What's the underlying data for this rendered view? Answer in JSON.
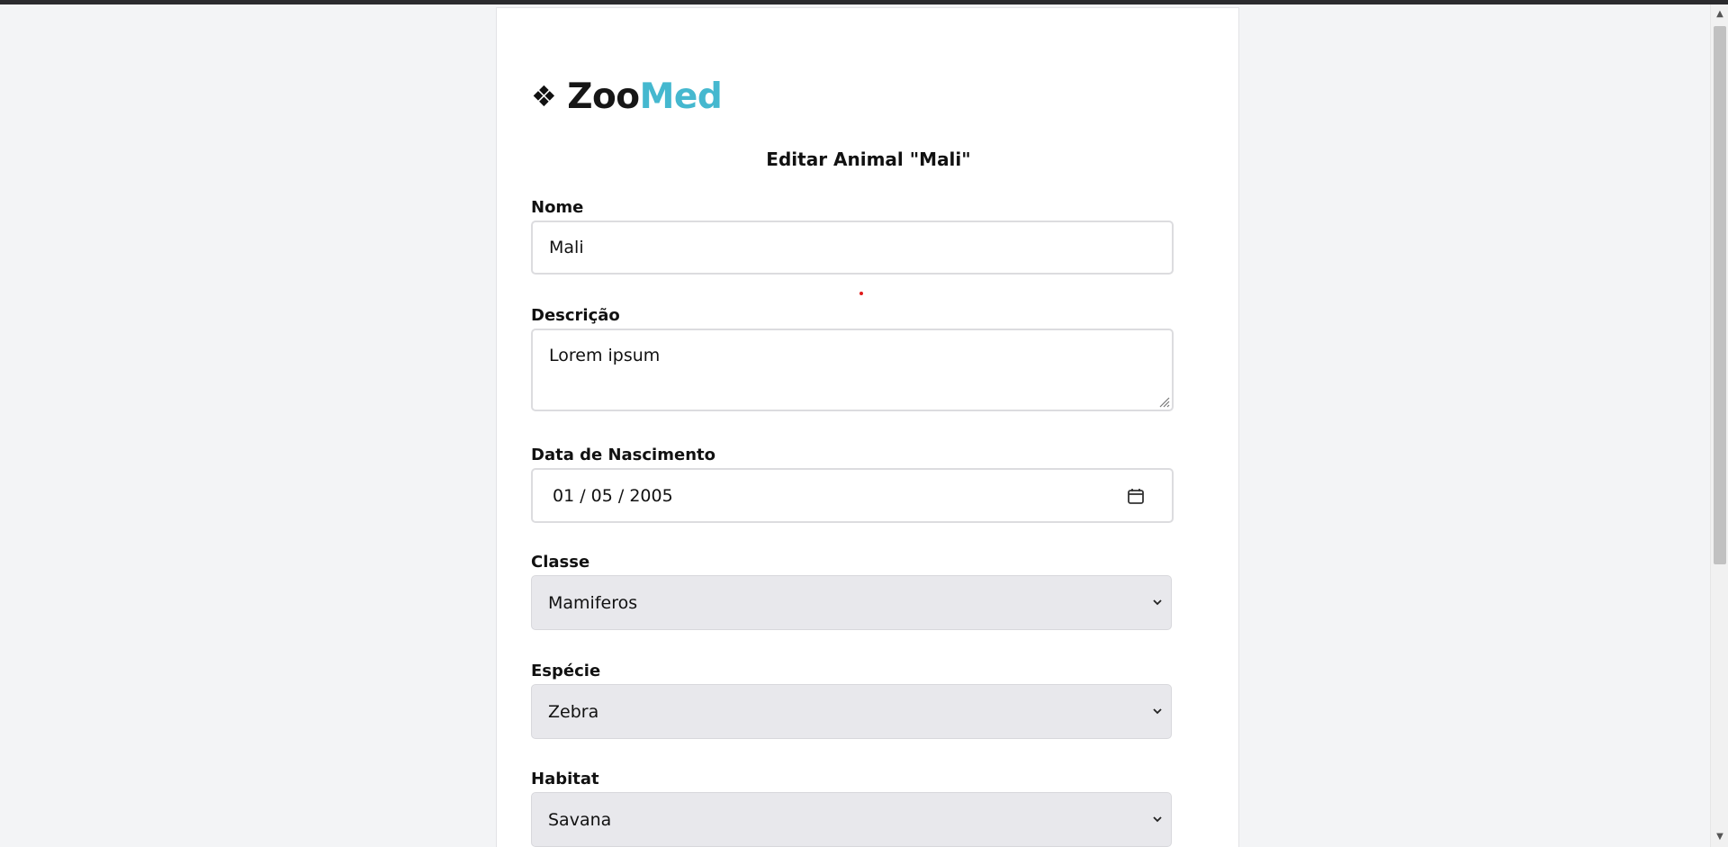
{
  "logo": {
    "icon": "❖",
    "part1": "Zoo",
    "part2": "Med",
    "accent_color": "#45b8cf"
  },
  "form": {
    "title": "Editar Animal \"Mali\"",
    "nome": {
      "label": "Nome",
      "value": "Mali"
    },
    "descricao": {
      "label": "Descrição",
      "value": "Lorem ipsum"
    },
    "nascimento": {
      "label": "Data de Nascimento",
      "value": "01 / 05 / 2005"
    },
    "classe": {
      "label": "Classe",
      "value": "Mamiferos"
    },
    "especie": {
      "label": "Espécie",
      "value": "Zebra"
    },
    "habitat": {
      "label": "Habitat",
      "value": "Savana"
    }
  }
}
